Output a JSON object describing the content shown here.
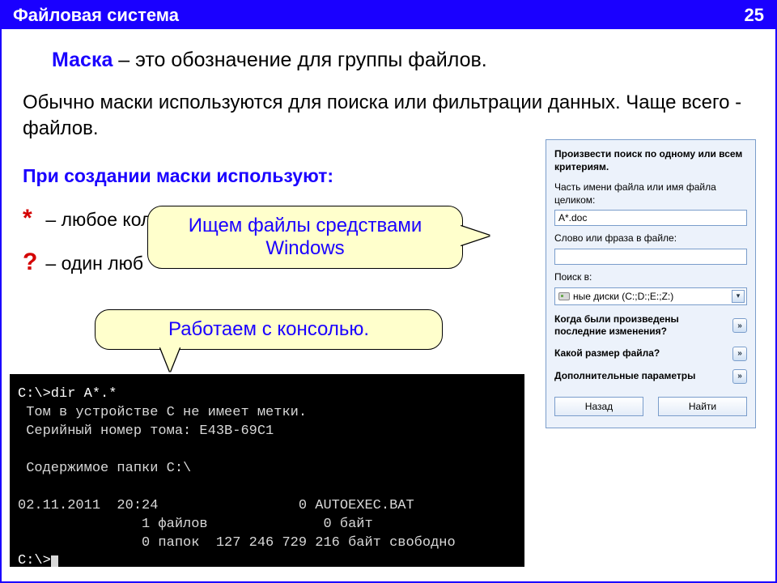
{
  "titlebar": {
    "title": "Файловая система",
    "page": "25"
  },
  "lead": {
    "term": "Маска",
    "rest": " – это обозначение для группы файлов."
  },
  "para": "Обычно маски используются для поиска или фильтрации данных. Чаще всего - файлов.",
  "subhead": "При создании маски используют:",
  "bullets": {
    "star": {
      "sym": "*",
      "text": " – любое кол                                               том ч"
    },
    "qmark": {
      "sym": "?",
      "text": " – один люб"
    }
  },
  "callouts": {
    "c1": "Ищем файлы средствами Windows",
    "c2": "Работаем с консолью."
  },
  "search": {
    "hdr": "Произвести поиск по одному или всем критериям.",
    "name_lbl": "Часть имени файла или имя файла целиком:",
    "name_val": "A*.doc",
    "phrase_lbl": "Слово или фраза в файле:",
    "phrase_val": "",
    "loc_lbl": "Поиск в:",
    "loc_val": "ные диски (C:;D:;E:;Z:)",
    "exp1": "Когда были произведены последние изменения?",
    "exp2": "Какой размер файла?",
    "exp3": "Дополнительные параметры",
    "back": "Назад",
    "find": "Найти"
  },
  "console": {
    "l1": "C:\\>dir A*.*",
    "l2": " Том в устройстве C не имеет метки.",
    "l3": " Серийный номер тома: E43B-69C1",
    "l4": "",
    "l5": " Содержимое папки C:\\",
    "l6": "",
    "l7": "02.11.2011  20:24                 0 AUTOEXEC.BAT",
    "l8": "               1 файлов              0 байт",
    "l9": "               0 папок  127 246 729 216 байт свободно",
    "l10": "C:\\>"
  }
}
